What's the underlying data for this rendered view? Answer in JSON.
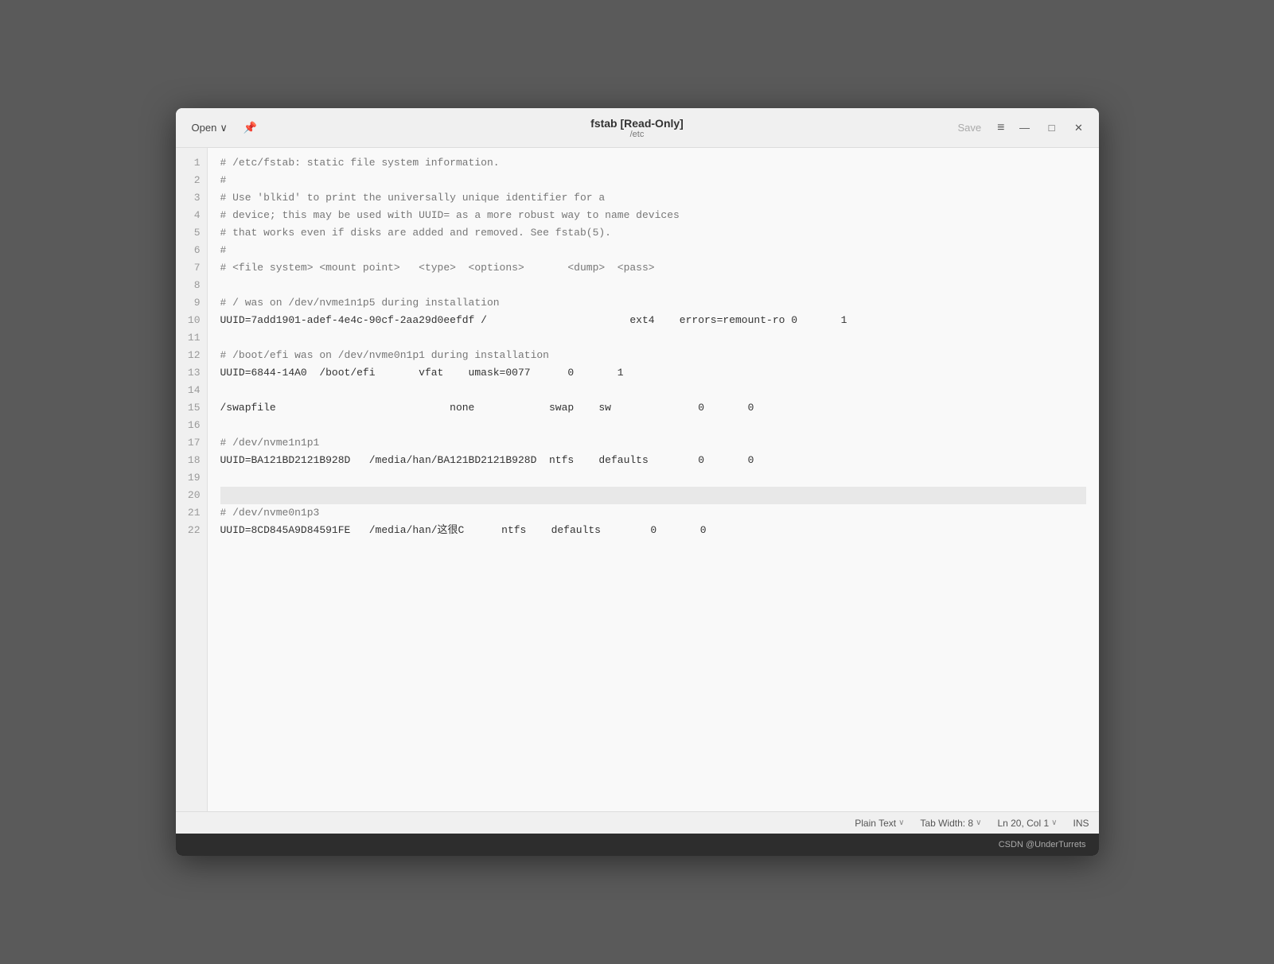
{
  "window": {
    "title": "fstab [Read-Only]",
    "subtitle": "/etc",
    "save_label": "Save",
    "menu_icon": "≡",
    "open_label": "Open",
    "open_chevron": "∨"
  },
  "window_controls": {
    "minimize": "—",
    "maximize": "□",
    "close": "✕"
  },
  "lines": [
    {
      "num": 1,
      "text": "# /etc/fstab: static file system information.",
      "comment": true,
      "highlighted": false
    },
    {
      "num": 2,
      "text": "#",
      "comment": true,
      "highlighted": false
    },
    {
      "num": 3,
      "text": "# Use 'blkid' to print the universally unique identifier for a",
      "comment": true,
      "highlighted": false
    },
    {
      "num": 4,
      "text": "# device; this may be used with UUID= as a more robust way to name devices",
      "comment": true,
      "highlighted": false
    },
    {
      "num": 5,
      "text": "# that works even if disks are added and removed. See fstab(5).",
      "comment": true,
      "highlighted": false
    },
    {
      "num": 6,
      "text": "#",
      "comment": true,
      "highlighted": false
    },
    {
      "num": 7,
      "text": "# <file system> <mount point>   <type>  <options>       <dump>  <pass>",
      "comment": true,
      "highlighted": false
    },
    {
      "num": 8,
      "text": "",
      "comment": false,
      "highlighted": false
    },
    {
      "num": 9,
      "text": "# / was on /dev/nvme1n1p5 during installation",
      "comment": true,
      "highlighted": false
    },
    {
      "num": 10,
      "text": "UUID=7add1901-adef-4e4c-90cf-2aa29d0eefdf /                       ext4    errors=remount-ro 0       1",
      "comment": false,
      "highlighted": false
    },
    {
      "num": 11,
      "text": "",
      "comment": false,
      "highlighted": false
    },
    {
      "num": 12,
      "text": "# /boot/efi was on /dev/nvme0n1p1 during installation",
      "comment": true,
      "highlighted": false
    },
    {
      "num": 13,
      "text": "UUID=6844-14A0  /boot/efi       vfat    umask=0077      0       1",
      "comment": false,
      "highlighted": false
    },
    {
      "num": 14,
      "text": "",
      "comment": false,
      "highlighted": false
    },
    {
      "num": 15,
      "text": "/swapfile                            none            swap    sw              0       0",
      "comment": false,
      "highlighted": false
    },
    {
      "num": 16,
      "text": "",
      "comment": false,
      "highlighted": false
    },
    {
      "num": 17,
      "text": "# /dev/nvme1n1p1",
      "comment": true,
      "highlighted": false
    },
    {
      "num": 18,
      "text": "UUID=BA121BD2121B928D   /media/han/BA121BD2121B928D  ntfs    defaults        0       0",
      "comment": false,
      "highlighted": false
    },
    {
      "num": 19,
      "text": "",
      "comment": false,
      "highlighted": false
    },
    {
      "num": 20,
      "text": "",
      "comment": false,
      "highlighted": true
    },
    {
      "num": 21,
      "text": "# /dev/nvme0n1p3",
      "comment": true,
      "highlighted": false
    },
    {
      "num": 22,
      "text": "UUID=8CD845A9D84591FE   /media/han/这很C      ntfs    defaults        0       0",
      "comment": false,
      "highlighted": false
    }
  ],
  "statusbar": {
    "language": "Plain Text",
    "tab_width": "Tab Width: 8",
    "cursor": "Ln 20, Col 1",
    "encoding": "",
    "mode": "INS",
    "language_chevron": "∨",
    "tab_chevron": "∨",
    "cursor_chevron": "∨"
  },
  "bottombar": {
    "text": "CSDN @UnderTurrets"
  }
}
